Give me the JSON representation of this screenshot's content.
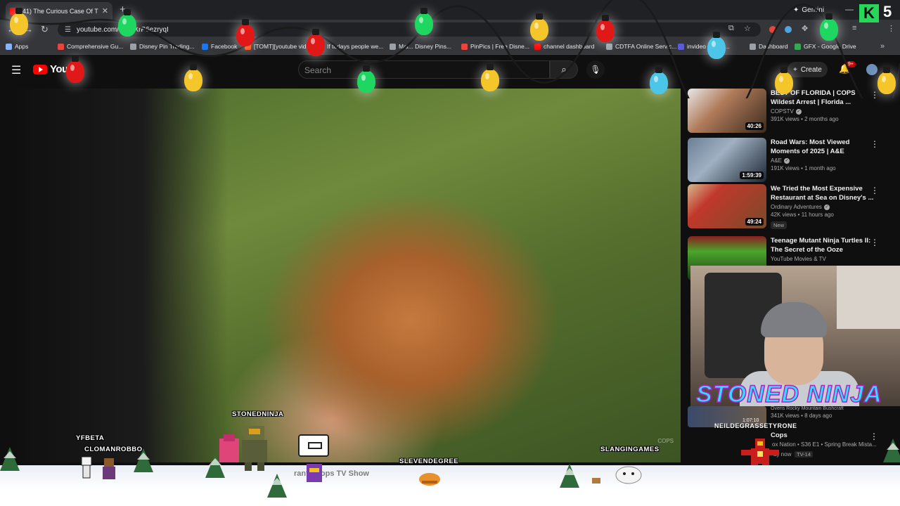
{
  "browser": {
    "tab_title": "(41) The Curious Case Of Th",
    "tab_close": "✕",
    "new_tab": "+",
    "gemini_label": "Gemini",
    "url": "youtube.com/w     =aXrP6ezryqI",
    "minimize": "—",
    "close": "✕"
  },
  "bookmarks": [
    {
      "label": "Apps",
      "color": "#8ab4f8"
    },
    {
      "label": "Comprehensive Gu...",
      "color": "#e8453c"
    },
    {
      "label": "Disney Pin Trading...",
      "color": "#9aa0a6"
    },
    {
      "label": "Facebook",
      "color": "#1877f2"
    },
    {
      "label": "[TOMT][youtube vid...",
      "color": "#ff4500"
    },
    {
      "label": "If todays people we...",
      "color": "#9aa0a6"
    },
    {
      "label": "Mai... Disney Pins...",
      "color": "#9aa0a6"
    },
    {
      "label": "PinPics | Free Disne...",
      "color": "#e8453c"
    },
    {
      "label": "channel dashboard",
      "color": "#ff0000"
    },
    {
      "label": "CDTFA Online Servic...",
      "color": "#9aa0a6"
    },
    {
      "label": "invideo",
      "color": "#5b5bd6"
    },
    {
      "label": "id...",
      "color": "#9aa0a6"
    },
    {
      "label": "Dashboard",
      "color": "#9aa0a6"
    },
    {
      "label": "GFX - Google Drive",
      "color": "#34a853"
    }
  ],
  "youtube": {
    "logo_text": "YouT",
    "search_placeholder": "Search",
    "create_label": "Create",
    "notif_count": "9+"
  },
  "recommendations": [
    {
      "title": "BEST OF FLORIDA | COPS Wildest Arrest | Florida ...",
      "channel": "COPSTV",
      "verified": true,
      "views": "391K views • 2 months ago",
      "duration": "40:26",
      "thumb_colors": [
        "#e8e8e8",
        "#3b2a1c"
      ],
      "new": false
    },
    {
      "title": "Road Wars: Most Viewed Moments of 2025 | A&E",
      "channel": "A&E",
      "verified": true,
      "views": "191K views • 1 month ago",
      "duration": "1:59:39",
      "thumb_colors": [
        "#6c7f93",
        "#1c2633"
      ],
      "new": false
    },
    {
      "title": "We Tried the Most Expensive Restaurant at Sea on Disney's ...",
      "channel": "Ordinary Adventures",
      "verified": true,
      "views": "42K views • 11 hours ago",
      "duration": "49:24",
      "thumb_colors": [
        "#d7b890",
        "#7a4a2a"
      ],
      "new": true,
      "new_label": "New"
    },
    {
      "title": "Teenage Mutant Ninja Turtles II: The Secret of the Ooze",
      "channel": "YouTube Movies & TV",
      "verified": false,
      "views": "",
      "duration": "",
      "thumb_colors": [
        "#4aa52b",
        "#1b3a12"
      ],
      "new": false
    }
  ],
  "overlay": {
    "brand_k": "K",
    "brand_5": "5",
    "stoned_ninja": "STONED NINJA",
    "partial_channel": "Ovens Rocky Mountain Bushcraft",
    "partial_views": "341K views • 8 days ago",
    "partial_duration": "1:07:10",
    "tyrone": "NEILDEGRASSETYRONE",
    "cops_title": "Cops",
    "cops_channel": "ox Nation • S36 E1 • Spring Break Mista...",
    "cops_now": "ay now",
    "cops_rating": "TV-14",
    "under_video_title": "rant | Cops TV Show"
  },
  "game_names": {
    "yfbeta": "YFBETA",
    "clomanrobbo": "CLOMANROBBO",
    "stonedninja": "STONEDNINJA",
    "slevendegree": "SLEVENDEGREE",
    "slanginggames": "SLANGINGAMES"
  },
  "video": {
    "watermark": "COPS"
  }
}
